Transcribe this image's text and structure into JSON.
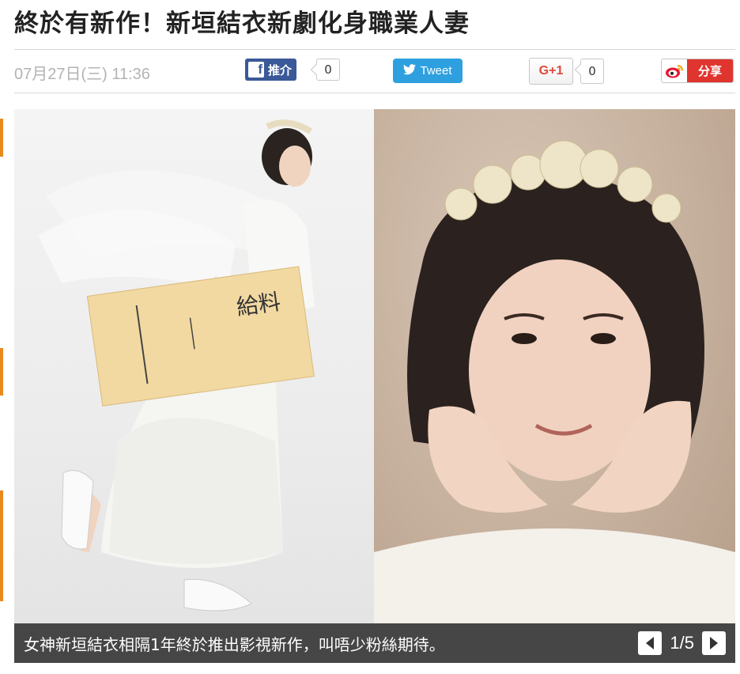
{
  "article": {
    "title": "終於有新作！新垣結衣新劇化身職業人妻",
    "datetime": "07月27日(三) 11:36"
  },
  "share": {
    "facebook": {
      "icon": "facebook-icon",
      "label": "推介",
      "count": "0",
      "color": "#3b5998"
    },
    "twitter": {
      "icon": "twitter-bird-icon",
      "label": "Tweet",
      "color": "#2ea0e0"
    },
    "googleplus": {
      "label": "G+1",
      "count": "0",
      "color": "#dd4b39"
    },
    "weibo": {
      "icon": "weibo-icon",
      "label": "分享",
      "color": "#e0352f"
    }
  },
  "gallery": {
    "caption": "女神新垣結衣相隔1年終於推出影視新作，叫唔少粉絲期待。",
    "page": "1/5",
    "prev_icon": "chevron-left-icon",
    "next_icon": "chevron-right-icon",
    "envelope_text": "給料"
  },
  "accent_color": "#e8891f"
}
